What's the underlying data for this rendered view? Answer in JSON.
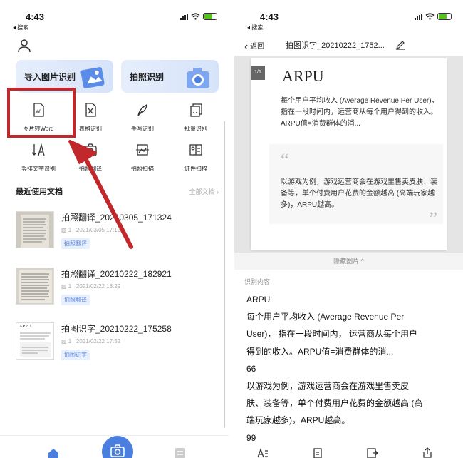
{
  "status": {
    "time": "4:43",
    "back_app": "◂ 搜索"
  },
  "left": {
    "cards": [
      {
        "label": "导入图片识别"
      },
      {
        "label": "拍照识别"
      }
    ],
    "tools_row1": [
      "图片转Word",
      "表格识别",
      "手写识别",
      "批量识别"
    ],
    "tools_row2": [
      "竖排文字识别",
      "拍照翻译",
      "拍照扫描",
      "证件扫描"
    ],
    "recent_title": "最近使用文档",
    "all_docs": "全部文档",
    "docs": [
      {
        "name": "拍照翻译_20210305_171324",
        "pages": "1",
        "date": "2021/03/05 17:13",
        "tag": "拍照翻译"
      },
      {
        "name": "拍照翻译_20210222_182921",
        "pages": "1",
        "date": "2021/02/22 18:29",
        "tag": "拍照翻译"
      },
      {
        "name": "拍图识字_20210222_175258",
        "pages": "1",
        "date": "2021/02/22 17:52",
        "tag": "拍图识字"
      }
    ],
    "thumb_title": "ARPU",
    "accent": "#4a7fe0",
    "highlight": "#c0282c"
  },
  "right": {
    "back": "返回",
    "title": "拍图识字_20210222_1752...",
    "page_badge": "1/1",
    "paper_title": "ARPU",
    "paper_para": "每个用户平均收入 (Average Revenue Per User)，指在一段时间内，运营商从每个用户得到的收入。ARPU值=消费群体的消...",
    "quote_open": "“",
    "quote_close": "”",
    "quote_para": "以游戏为例，游戏运营商会在游戏里售卖皮肤、装备等，单个付费用户花费的金额越高 (高端玩家越多)，ARPU越高。",
    "hide_image": "隐藏图片 ^",
    "recognized_label": "识别内容",
    "recognized_lines": [
      "ARPU",
      "每个用户平均收入 (Average Revenue Per",
      "User)，  指在一段时间内，  运营商从每个用户",
      "得到的收入。ARPU值=消费群体的消...",
      "66",
      "以游戏为例，游戏运营商会在游戏里售卖皮",
      "肤、装备等，单个付费用户花费的金额越高 (高",
      "端玩家越多)，ARPU越高。",
      "99"
    ]
  }
}
